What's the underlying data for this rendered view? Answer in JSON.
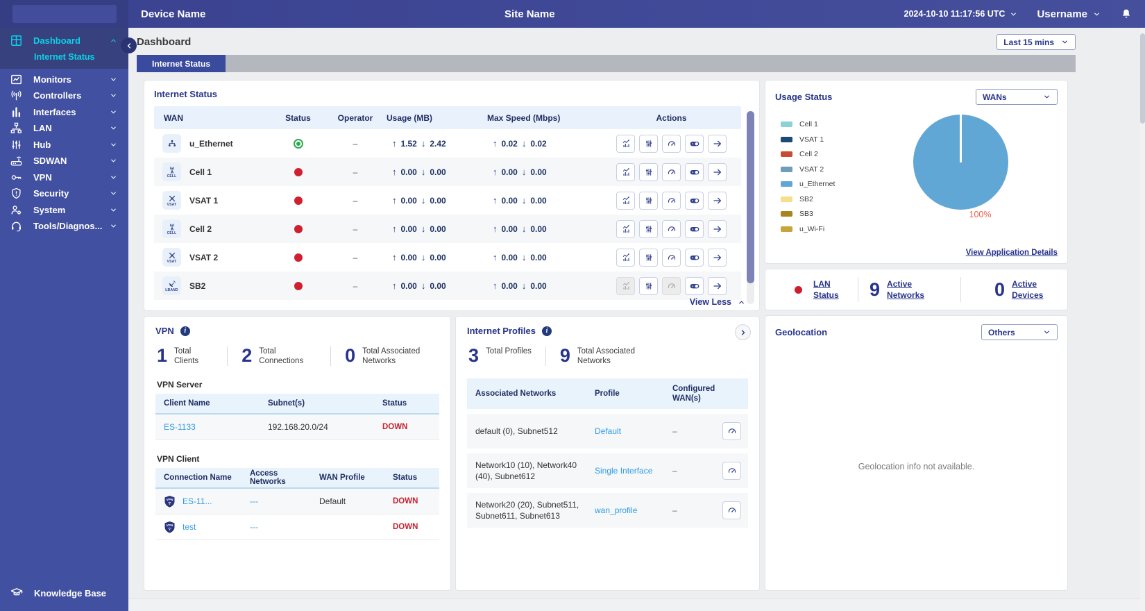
{
  "topbar": {
    "device_name": "Device Name",
    "site_name": "Site Name",
    "timestamp": "2024-10-10 11:17:56 UTC",
    "username": "Username"
  },
  "sidebar": {
    "items": [
      {
        "label": "Dashboard"
      },
      {
        "label": "Monitors"
      },
      {
        "label": "Controllers"
      },
      {
        "label": "Interfaces"
      },
      {
        "label": "LAN"
      },
      {
        "label": "Hub"
      },
      {
        "label": "SDWAN"
      },
      {
        "label": "VPN"
      },
      {
        "label": "Security"
      },
      {
        "label": "System"
      },
      {
        "label": "Tools/Diagnos..."
      }
    ],
    "dashboard_sub_item": "Internet Status",
    "footer_label": "Knowledge Base"
  },
  "page": {
    "title": "Dashboard",
    "active_tab": "Internet Status",
    "time_filter": "Last 15 mins"
  },
  "internet_status": {
    "title": "Internet Status",
    "columns": {
      "wan": "WAN",
      "status": "Status",
      "operator": "Operator",
      "usage": "Usage (MB)",
      "max_speed": "Max Speed (Mbps)",
      "actions": "Actions"
    },
    "rows": [
      {
        "name": "u_Ethernet",
        "icon": "ethernet-icon",
        "icon_label": "",
        "status": "up",
        "operator": "–",
        "usage_up": "1.52",
        "usage_down": "2.42",
        "speed_up": "0.02",
        "speed_down": "0.02"
      },
      {
        "name": "Cell 1",
        "icon": "cell-icon",
        "icon_label": "CELL",
        "status": "down",
        "operator": "–",
        "usage_up": "0.00",
        "usage_down": "0.00",
        "speed_up": "0.00",
        "speed_down": "0.00"
      },
      {
        "name": "VSAT 1",
        "icon": "vsat-icon",
        "icon_label": "VSAT",
        "status": "down",
        "operator": "–",
        "usage_up": "0.00",
        "usage_down": "0.00",
        "speed_up": "0.00",
        "speed_down": "0.00"
      },
      {
        "name": "Cell 2",
        "icon": "cell-icon",
        "icon_label": "CELL",
        "status": "down",
        "operator": "–",
        "usage_up": "0.00",
        "usage_down": "0.00",
        "speed_up": "0.00",
        "speed_down": "0.00"
      },
      {
        "name": "VSAT 2",
        "icon": "vsat-icon",
        "icon_label": "VSAT",
        "status": "down",
        "operator": "–",
        "usage_up": "0.00",
        "usage_down": "0.00",
        "speed_up": "0.00",
        "speed_down": "0.00"
      },
      {
        "name": "SB2",
        "icon": "lband-icon",
        "icon_label": "LBAND",
        "status": "down",
        "operator": "–",
        "usage_up": "0.00",
        "usage_down": "0.00",
        "speed_up": "0.00",
        "speed_down": "0.00",
        "disabled_actions": true
      }
    ],
    "view_less_label": "View Less"
  },
  "usage_status": {
    "title": "Usage Status",
    "filter_value": "WANs",
    "pie_color": "#61A7D5",
    "pct_label": "100%",
    "details_link": "View Application Details",
    "legend": [
      {
        "label": "Cell 1",
        "color": "#8ED1D4"
      },
      {
        "label": "VSAT 1",
        "color": "#1B4A77"
      },
      {
        "label": "Cell 2",
        "color": "#C44E35"
      },
      {
        "label": "VSAT 2",
        "color": "#719CBA"
      },
      {
        "label": "u_Ethernet",
        "color": "#61A7D5"
      },
      {
        "label": "SB2",
        "color": "#F6DE8D"
      },
      {
        "label": "SB3",
        "color": "#A6841F"
      },
      {
        "label": "u_Wi-Fi",
        "color": "#C9A33B"
      }
    ],
    "chart_data": {
      "type": "pie",
      "labels": [
        "Cell 1",
        "VSAT 1",
        "Cell 2",
        "VSAT 2",
        "u_Ethernet",
        "SB2",
        "SB3",
        "u_Wi-Fi"
      ],
      "values": [
        0,
        0,
        0,
        0,
        100,
        0,
        0,
        0
      ],
      "colors": [
        "#8ED1D4",
        "#1B4A77",
        "#C44E35",
        "#719CBA",
        "#61A7D5",
        "#F6DE8D",
        "#A6841F",
        "#C9A33B"
      ],
      "annotation": "100%",
      "legend_position": "left"
    }
  },
  "lan_status": {
    "lan_link": "LAN Status",
    "active_networks_value": "9",
    "active_networks_label": "Active Networks",
    "active_devices_value": "0",
    "active_devices_label": "Active Devices"
  },
  "vpn": {
    "title": "VPN",
    "stats": [
      {
        "value": "1",
        "label": "Total Clients"
      },
      {
        "value": "2",
        "label": "Total Connections"
      },
      {
        "value": "0",
        "label": "Total Associated Networks"
      }
    ],
    "server": {
      "title": "VPN Server",
      "columns": {
        "client": "Client Name",
        "subnets": "Subnet(s)",
        "status": "Status"
      },
      "rows": [
        {
          "client": "ES-1133",
          "subnets": "192.168.20.0/24",
          "status": "DOWN"
        }
      ]
    },
    "client": {
      "title": "VPN Client",
      "columns": {
        "connection": "Connection Name",
        "access": "Access Networks",
        "wan_profile": "WAN Profile",
        "status": "Status"
      },
      "rows": [
        {
          "connection": "ES-11...",
          "access": "---",
          "wan_profile": "Default",
          "status": "DOWN"
        },
        {
          "connection": "test",
          "access": "---",
          "wan_profile": "",
          "status": "DOWN"
        }
      ]
    }
  },
  "internet_profiles": {
    "title": "Internet Profiles",
    "stats": [
      {
        "value": "3",
        "label": "Total Profiles"
      },
      {
        "value": "9",
        "label": "Total Associated Networks"
      }
    ],
    "columns": {
      "networks": "Associated Networks",
      "profile": "Profile",
      "wans": "Configured WAN(s)"
    },
    "rows": [
      {
        "networks": "default (0), Subnet512",
        "profile": "Default",
        "wans": "–"
      },
      {
        "networks": "Network10 (10), Network40 (40), Subnet612",
        "profile": "Single Interface",
        "wans": "–"
      },
      {
        "networks": "Network20 (20), Subnet511, Subnet611, Subnet613",
        "profile": "wan_profile",
        "wans": "–"
      }
    ]
  },
  "geolocation": {
    "title": "Geolocation",
    "filter_value": "Others",
    "empty_message": "Geolocation info not available."
  }
}
